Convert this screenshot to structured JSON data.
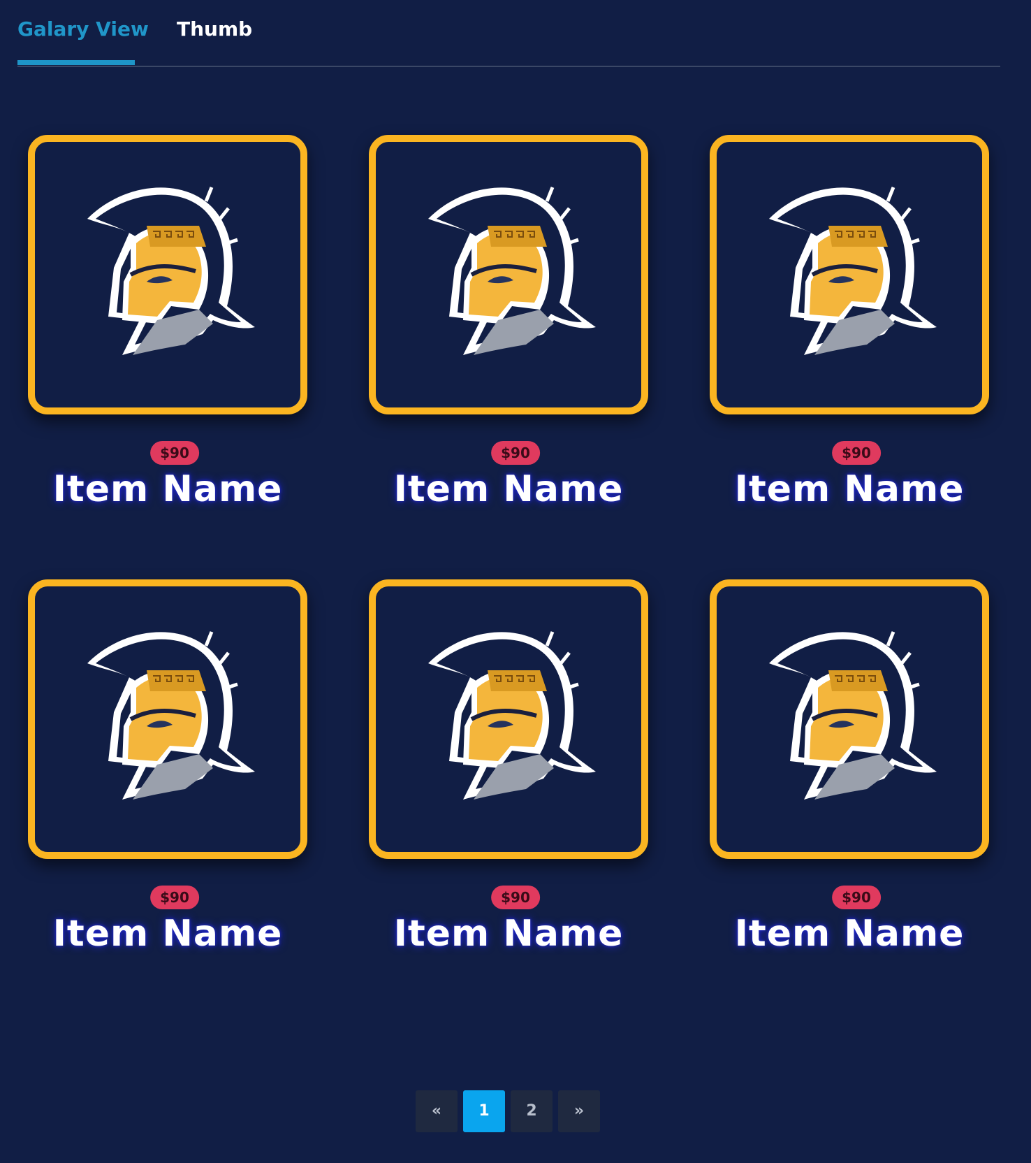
{
  "tabs": [
    {
      "label": "Galary View",
      "active": true
    },
    {
      "label": "Thumb",
      "active": false
    }
  ],
  "items": [
    {
      "price": "$90",
      "name": "Item Name",
      "image": "spartan-helmet-logo"
    },
    {
      "price": "$90",
      "name": "Item Name",
      "image": "spartan-helmet-logo"
    },
    {
      "price": "$90",
      "name": "Item Name",
      "image": "spartan-helmet-logo"
    },
    {
      "price": "$90",
      "name": "Item Name",
      "image": "spartan-helmet-logo"
    },
    {
      "price": "$90",
      "name": "Item Name",
      "image": "spartan-helmet-logo"
    },
    {
      "price": "$90",
      "name": "Item Name",
      "image": "spartan-helmet-logo"
    }
  ],
  "pagination": {
    "prev": "«",
    "pages": [
      "1",
      "2"
    ],
    "current": "1",
    "next": "»"
  },
  "colors": {
    "background": "#111e45",
    "frame_border": "#fbb521",
    "active_tab": "#2096c9",
    "price_badge": "#e03a5e",
    "active_page": "#0aa5ee"
  }
}
